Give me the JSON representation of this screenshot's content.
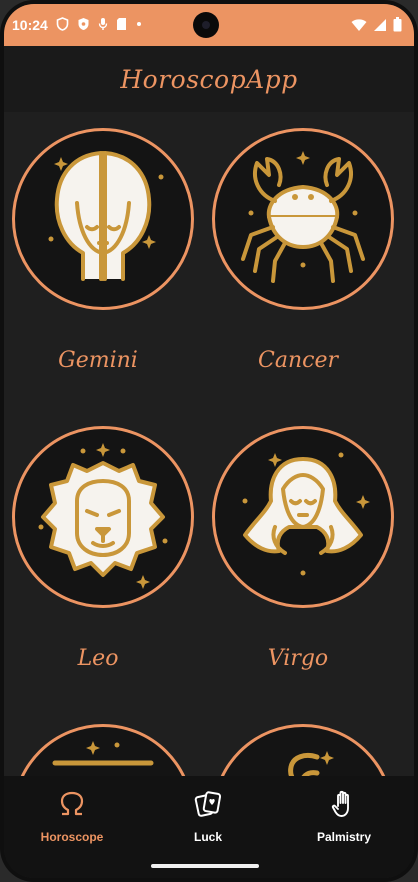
{
  "status_bar": {
    "time": "10:24",
    "left_icons": [
      "shield-icon",
      "vpn-key-icon",
      "mic-off-icon",
      "sd-card-icon",
      "dot-icon"
    ],
    "right_icons": [
      "wifi-icon",
      "signal-icon",
      "battery-icon"
    ]
  },
  "app_bar": {
    "title": "HoroscopApp"
  },
  "signs": [
    {
      "name": "Gemini",
      "icon": "gemini-icon"
    },
    {
      "name": "Cancer",
      "icon": "cancer-icon"
    },
    {
      "name": "Leo",
      "icon": "leo-icon"
    },
    {
      "name": "Virgo",
      "icon": "virgo-icon"
    },
    {
      "name": "",
      "icon": "libra-icon"
    },
    {
      "name": "",
      "icon": "scorpio-icon"
    }
  ],
  "bottom_nav": {
    "items": [
      {
        "label": "Horoscope",
        "icon": "omega-icon",
        "active": true
      },
      {
        "label": "Luck",
        "icon": "cards-icon",
        "active": false
      },
      {
        "label": "Palmistry",
        "icon": "hand-icon",
        "active": false
      }
    ]
  },
  "colors": {
    "accent": "#ec9462",
    "gold": "#c9973a",
    "background": "#1f1f1f",
    "circle_fill": "#141414"
  }
}
